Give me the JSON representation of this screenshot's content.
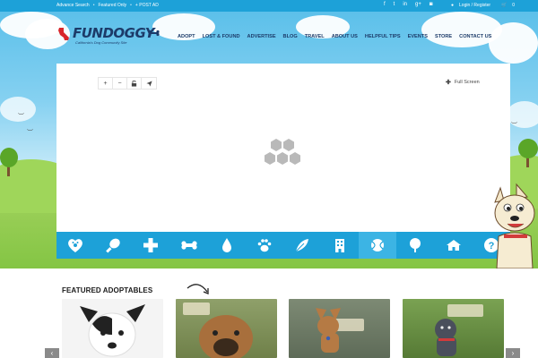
{
  "topbar": {
    "links": [
      "Advance Search",
      "Featured Only",
      "+ POST AD"
    ],
    "social_icons": [
      "facebook-icon",
      "twitter-icon",
      "linkedin-icon",
      "google-plus-icon",
      "instagram-icon"
    ],
    "login_label": "Login / Register",
    "cart_count": "0"
  },
  "logo": {
    "wordmark": "FUNDOGGY",
    "tagline": "California's Dog Community Site"
  },
  "nav": [
    "ADOPT",
    "LOST & FOUND",
    "ADVERTISE",
    "BLOG",
    "TRAVEL",
    "ABOUT US",
    "HELPFUL TIPS",
    "EVENTS",
    "STORE",
    "CONTACT US"
  ],
  "map": {
    "controls": [
      "+",
      "−",
      "lock-icon",
      "send-icon"
    ],
    "fullscreen_label": "Full Screen"
  },
  "categories": [
    {
      "icon": "paw-heart-icon",
      "active": false
    },
    {
      "icon": "drumstick-icon",
      "active": false
    },
    {
      "icon": "medical-cross-icon",
      "active": false
    },
    {
      "icon": "bone-icon",
      "active": false
    },
    {
      "icon": "water-drop-icon",
      "active": false
    },
    {
      "icon": "paw-icon",
      "active": false
    },
    {
      "icon": "feather-icon",
      "active": false
    },
    {
      "icon": "building-icon",
      "active": false
    },
    {
      "icon": "ball-icon",
      "active": true
    },
    {
      "icon": "tree-icon",
      "active": false
    },
    {
      "icon": "house-icon",
      "active": false
    },
    {
      "icon": "question-icon",
      "active": false
    }
  ],
  "featured": {
    "title": "FEATURED ADOPTABLES",
    "pets": [
      {
        "name": "pet-photo-1",
        "colors": [
          "#ffffff",
          "#222222"
        ]
      },
      {
        "name": "pet-photo-2",
        "colors": [
          "#8fa06a",
          "#a86f3c"
        ]
      },
      {
        "name": "pet-photo-3",
        "colors": [
          "#6e7b6a",
          "#b57a44"
        ]
      },
      {
        "name": "pet-photo-4",
        "colors": [
          "#6f8e4a",
          "#4a4f5c"
        ]
      }
    ]
  },
  "colors": {
    "brand_blue": "#1da1d8",
    "navy": "#1c3b69",
    "grass": "#84c544"
  }
}
